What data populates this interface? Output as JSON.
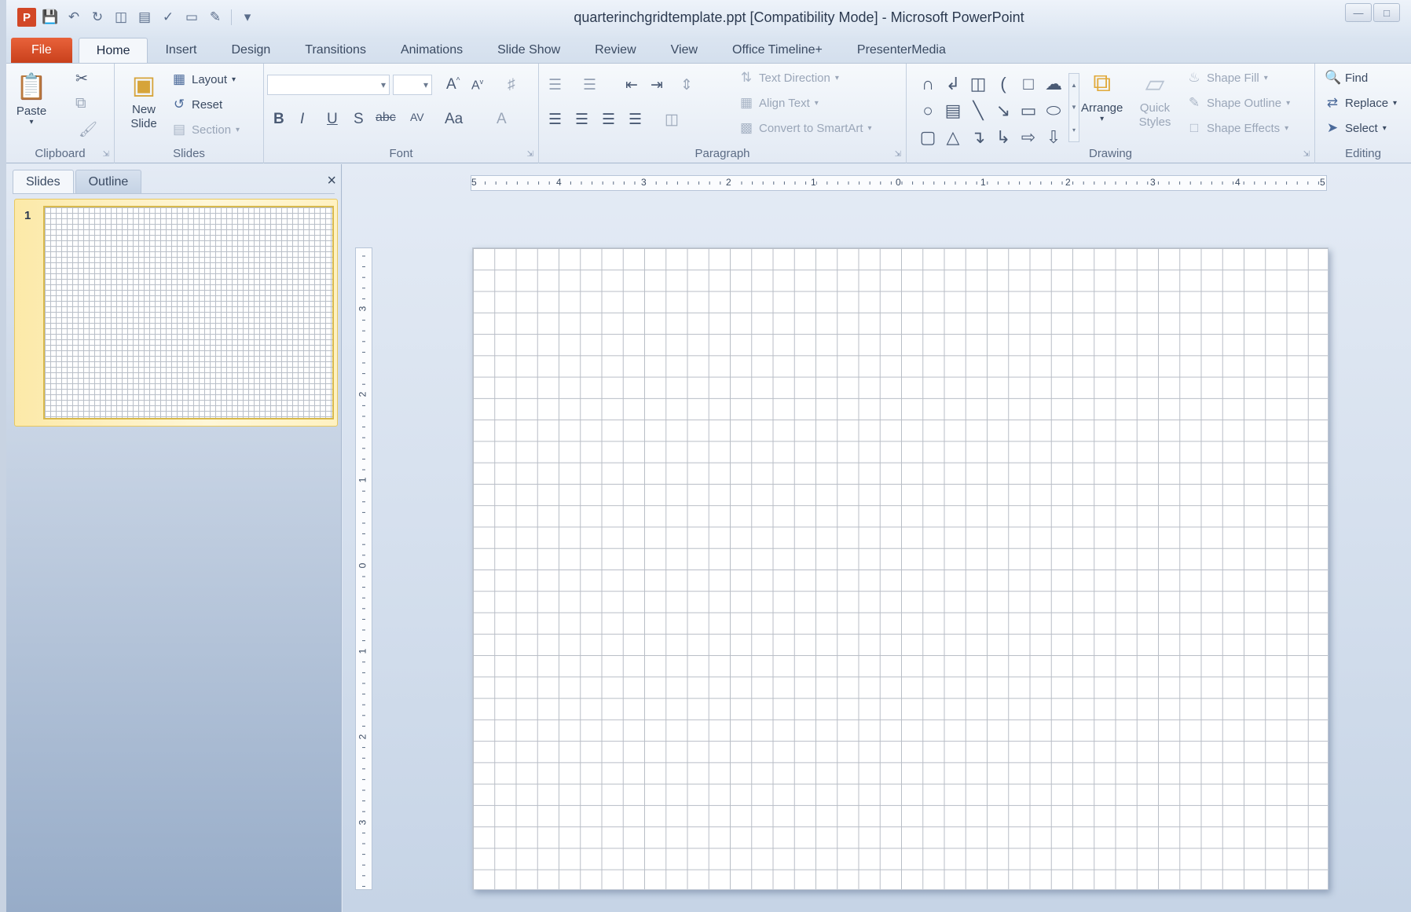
{
  "titlebar": {
    "title": "quarterinchgridtemplate.ppt [Compatibility Mode] - Microsoft PowerPoint",
    "app_icon": "P"
  },
  "tabs": [
    "File",
    "Home",
    "Insert",
    "Design",
    "Transitions",
    "Animations",
    "Slide Show",
    "Review",
    "View",
    "Office Timeline+",
    "PresenterMedia"
  ],
  "active_tab": "Home",
  "ribbon": {
    "clipboard": {
      "label": "Clipboard",
      "paste": "Paste"
    },
    "slides": {
      "label": "Slides",
      "new_slide": "New Slide",
      "layout": "Layout",
      "reset": "Reset",
      "section": "Section"
    },
    "font": {
      "label": "Font"
    },
    "paragraph": {
      "label": "Paragraph",
      "text_direction": "Text Direction",
      "align_text": "Align Text",
      "convert_smartart": "Convert to SmartArt"
    },
    "drawing": {
      "label": "Drawing",
      "arrange": "Arrange",
      "quick_styles": "Quick Styles",
      "shape_fill": "Shape Fill",
      "shape_outline": "Shape Outline",
      "shape_effects": "Shape Effects"
    },
    "editing": {
      "label": "Editing",
      "find": "Find",
      "replace": "Replace",
      "select": "Select"
    }
  },
  "pane": {
    "tab_slides": "Slides",
    "tab_outline": "Outline",
    "close": "×",
    "slide_number": "1"
  },
  "ruler": {
    "horizontal": [
      "5",
      "4",
      "3",
      "2",
      "1",
      "0",
      "1",
      "2",
      "3",
      "4",
      "5"
    ],
    "vertical": [
      "3",
      "2",
      "1",
      "0",
      "1",
      "2",
      "3"
    ]
  },
  "icons": {
    "app": "powerpoint-app-icon",
    "save": "save-icon",
    "undo": "undo-icon",
    "redo": "redo-icon"
  }
}
